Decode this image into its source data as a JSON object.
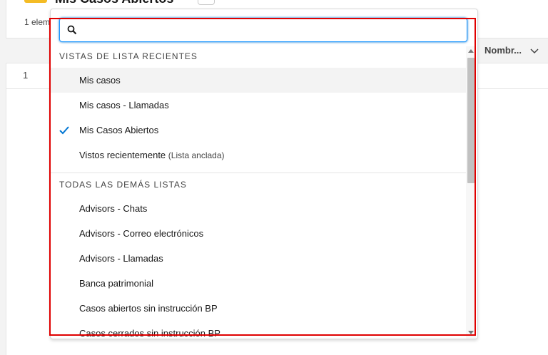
{
  "header": {
    "title": "Mis Casos Abiertos",
    "item_count": "1 eleme"
  },
  "table": {
    "column_header": "Nombr...",
    "row_number": "1"
  },
  "dropdown": {
    "search_value": "",
    "recent_section_title": "VISTAS DE LISTA RECIENTES",
    "recent_items": [
      {
        "label": "Mis casos",
        "active": true
      },
      {
        "label": "Mis casos - Llamadas"
      },
      {
        "label": "Mis Casos Abiertos",
        "checked": true
      },
      {
        "label": "Vistos recientemente",
        "note": "(Lista anclada)"
      }
    ],
    "all_section_title": "TODAS LAS DEMÁS LISTAS",
    "all_items": [
      {
        "label": "Advisors - Chats"
      },
      {
        "label": "Advisors - Correo electrónicos"
      },
      {
        "label": "Advisors - Llamadas"
      },
      {
        "label": "Banca patrimonial"
      },
      {
        "label": "Casos abiertos sin instrucción BP"
      },
      {
        "label": "Casos cerrados sin instrucción BP"
      }
    ]
  },
  "colors": {
    "accent": "#0176d3",
    "highlight": "#e00000",
    "title_icon": "#f4bc25"
  },
  "icons": [
    "search-icon",
    "check-icon",
    "chevron-down-icon",
    "scroll-up-arrow",
    "scroll-down-arrow"
  ]
}
